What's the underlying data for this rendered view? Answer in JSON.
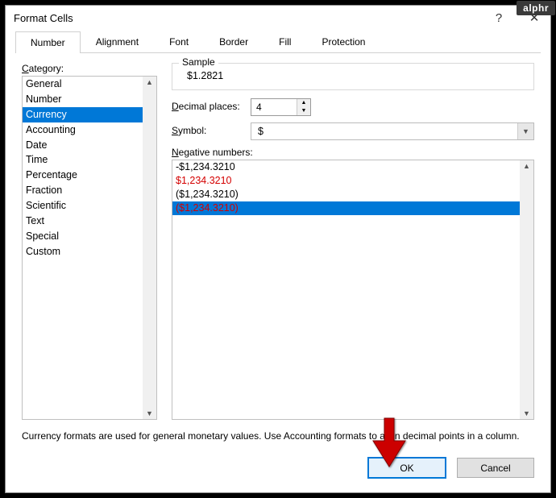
{
  "watermark": "alphr",
  "title": "Format Cells",
  "help_icon": "?",
  "close_icon": "✕",
  "tabs": [
    "Number",
    "Alignment",
    "Font",
    "Border",
    "Fill",
    "Protection"
  ],
  "category_label": "Category:",
  "categories": [
    "General",
    "Number",
    "Currency",
    "Accounting",
    "Date",
    "Time",
    "Percentage",
    "Fraction",
    "Scientific",
    "Text",
    "Special",
    "Custom"
  ],
  "selected_category_index": 2,
  "sample_label": "Sample",
  "sample_value": "$1.2821",
  "decimal_label": "Decimal places:",
  "decimal_value": "4",
  "symbol_label": "Symbol:",
  "symbol_value": "$",
  "negative_label": "Negative numbers:",
  "negative_options": [
    {
      "text": "-$1,234.3210",
      "style": "black"
    },
    {
      "text": "$1,234.3210",
      "style": "red"
    },
    {
      "text": "($1,234.3210)",
      "style": "black"
    },
    {
      "text": "($1,234.3210)",
      "style": "red-selected"
    }
  ],
  "hint_text": "Currency formats are used for general monetary values.  Use Accounting formats to align decimal points in a column.",
  "ok_label": "OK",
  "cancel_label": "Cancel"
}
